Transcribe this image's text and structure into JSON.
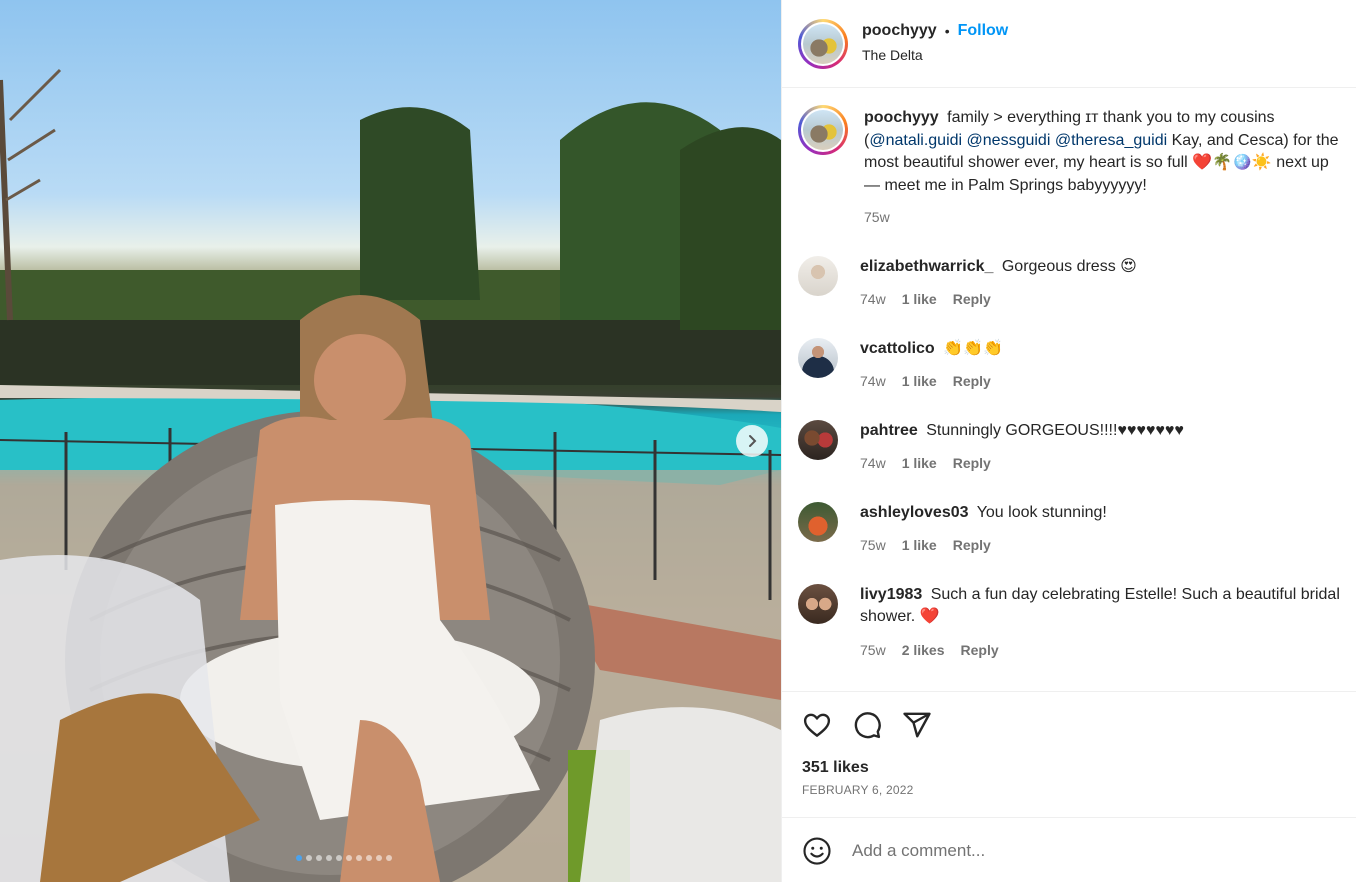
{
  "post": {
    "username": "poochyyy",
    "follow_label": "Follow",
    "location": "The Delta",
    "separator": "•"
  },
  "caption": {
    "username": "poochyyy",
    "text_1": "family > everything ɪᴛ thank you to my cousins (",
    "mention_1": "@natali.guidi",
    "mention_2": "@nessguidi",
    "mention_3": "@theresa_guidi",
    "text_2": " Kay, and Cesca) for the most beautiful shower ever, my heart is so full ❤️🌴🪩☀️ next up — meet me in Palm Springs babyyyyyy!",
    "time": "75w"
  },
  "comments": [
    {
      "username": "elizabethwarrick_",
      "text": "Gorgeous dress 😍",
      "time": "74w",
      "likes": "1 like",
      "reply": "Reply"
    },
    {
      "username": "vcattolico",
      "text": "👏👏👏",
      "time": "74w",
      "likes": "1 like",
      "reply": "Reply"
    },
    {
      "username": "pahtree",
      "text": "Stunningly GORGEOUS!!!!♥♥♥♥♥♥♥",
      "time": "74w",
      "likes": "1 like",
      "reply": "Reply"
    },
    {
      "username": "ashleyloves03",
      "text": "You look stunning!",
      "time": "75w",
      "likes": "1 like",
      "reply": "Reply"
    },
    {
      "username": "livy1983",
      "text": "Such a fun day celebrating Estelle! Such a beautiful bridal shower. ❤️",
      "time": "75w",
      "likes": "2 likes",
      "reply": "Reply"
    }
  ],
  "footer": {
    "likes": "351 likes",
    "date": "FEBRUARY 6, 2022",
    "comment_placeholder": "Add a comment..."
  },
  "carousel": {
    "total_slides": 10,
    "active_slide": 1
  },
  "icons": [
    "heart-icon",
    "comment-icon",
    "share-icon",
    "emoji-icon",
    "chevron-right-icon"
  ]
}
